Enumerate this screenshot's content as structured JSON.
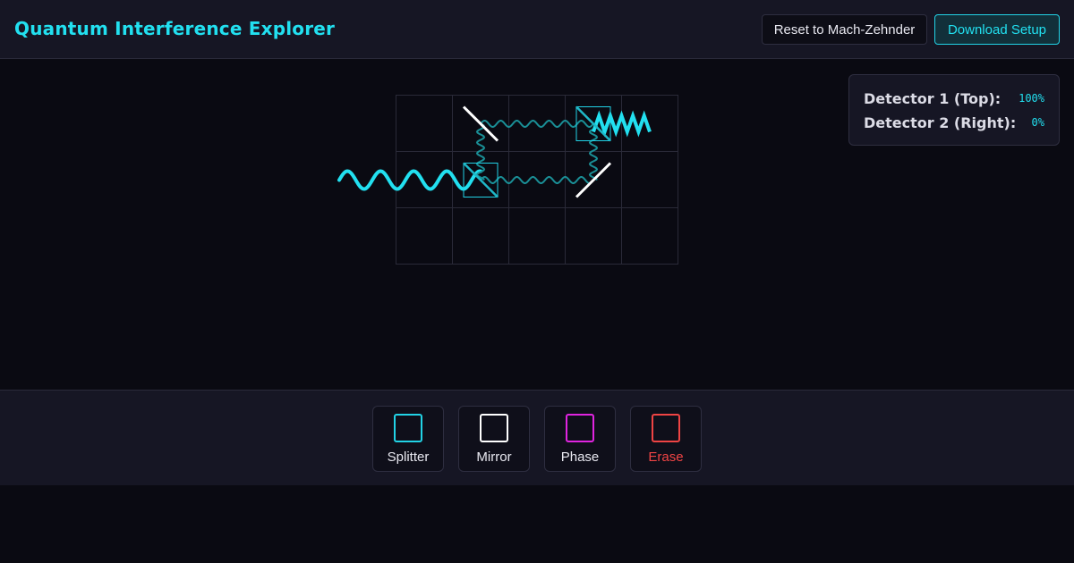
{
  "header": {
    "title": "Quantum Interference Explorer",
    "reset_label": "Reset to Mach-Zehnder",
    "download_label": "Download Setup"
  },
  "detectors": [
    {
      "label": "Detector 1 (Top):",
      "value": "100%"
    },
    {
      "label": "Detector 2 (Right):",
      "value": "0%"
    }
  ],
  "tools": [
    {
      "label": "Splitter",
      "color": "#22d3e6",
      "label_color": "#e8e8f0"
    },
    {
      "label": "Mirror",
      "color": "#ffffff",
      "label_color": "#e8e8f0"
    },
    {
      "label": "Phase",
      "color": "#e024e0",
      "label_color": "#e8e8f0"
    },
    {
      "label": "Erase",
      "color": "#ef4444",
      "label_color": "#ef4444"
    }
  ],
  "colors": {
    "accent": "#22e0f0",
    "beam": "#22e0f0",
    "beam_dim": "#1a8f96",
    "grid": "#2a2a38",
    "mirror": "#ffffff"
  }
}
